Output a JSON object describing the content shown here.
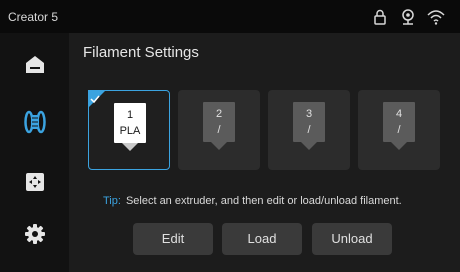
{
  "status_bar": {
    "title": "Creator 5",
    "icons": [
      "lock-icon",
      "camera-icon",
      "wifi-icon"
    ]
  },
  "sidebar": {
    "items": [
      {
        "name": "home",
        "icon": "home-icon"
      },
      {
        "name": "filament",
        "icon": "filament-spool-icon",
        "active": true
      },
      {
        "name": "calibration",
        "icon": "calibration-icon"
      },
      {
        "name": "settings",
        "icon": "gear-icon"
      }
    ]
  },
  "page": {
    "title": "Filament Settings"
  },
  "extruders": [
    {
      "number": "1",
      "material": "PLA",
      "selected": true
    },
    {
      "number": "2",
      "material": "/",
      "selected": false
    },
    {
      "number": "3",
      "material": "/",
      "selected": false
    },
    {
      "number": "4",
      "material": "/",
      "selected": false
    }
  ],
  "tip": {
    "label": "Tip:",
    "text": "Select an extruder, and then edit or load/unload filament."
  },
  "buttons": {
    "edit": "Edit",
    "load": "Load",
    "unload": "Unload"
  },
  "colors": {
    "accent": "#3ba3e0",
    "background": "#1c1c1c",
    "sidebar": "#121212",
    "statusbar": "#0a0a0a"
  }
}
